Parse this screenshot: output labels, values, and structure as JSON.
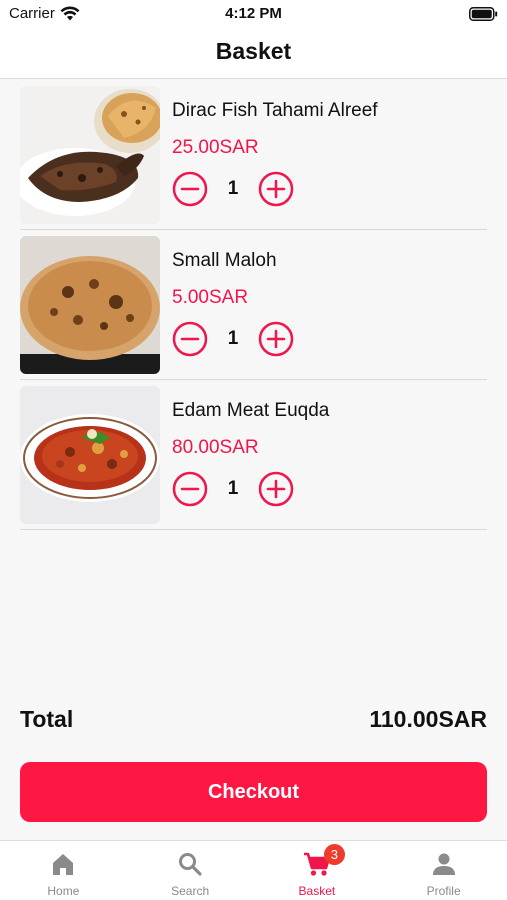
{
  "status_bar": {
    "carrier": "Carrier",
    "time": "4:12 PM"
  },
  "header": {
    "title": "Basket"
  },
  "items": [
    {
      "name": "Dirac Fish Tahami Alreef",
      "price": "25.00SAR",
      "quantity": "1"
    },
    {
      "name": "Small Maloh",
      "price": "5.00SAR",
      "quantity": "1"
    },
    {
      "name": "Edam Meat Euqda",
      "price": "80.00SAR",
      "quantity": "1"
    }
  ],
  "total": {
    "label": "Total",
    "value": "110.00SAR"
  },
  "checkout": {
    "label": "Checkout"
  },
  "tabs": [
    {
      "label": "Home",
      "icon": "home-icon"
    },
    {
      "label": "Search",
      "icon": "search-icon"
    },
    {
      "label": "Basket",
      "icon": "cart-icon",
      "badge": "3",
      "active": true
    },
    {
      "label": "Profile",
      "icon": "person-icon"
    }
  ],
  "colors": {
    "accent": "#f0154a",
    "button": "#ff1744",
    "badge": "#ef3b2c"
  }
}
